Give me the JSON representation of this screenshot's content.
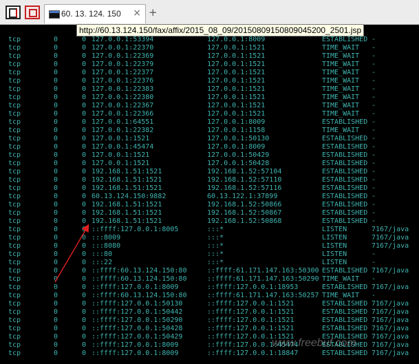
{
  "tab": {
    "title": "60. 13. 124. 150",
    "close_glyph": "×",
    "new_tab_glyph": "+"
  },
  "tooltip": "http://60.13.124.150/fax/affix/2015_08_09/20150809150809045200_2501.jsp",
  "colors": {
    "terminal_bg": "#000000",
    "terminal_text": "#3fb4b0",
    "arrow": "#e02020"
  },
  "icons": {
    "app": "terminal-window-icon",
    "close_all": "close-all-tabs-icon",
    "tab": "console-icon"
  },
  "rows": [
    [
      "tcp",
      "0",
      "0",
      "127.0.0.1:53394",
      "127.0.0.1:8009",
      "ESTABLISHED",
      "-"
    ],
    [
      "tcp",
      "0",
      "0",
      "127.0.0.1:22370",
      "127.0.0.1:1521",
      "TIME_WAIT",
      "-"
    ],
    [
      "tcp",
      "0",
      "0",
      "127.0.0.1:22369",
      "127.0.0.1:1521",
      "TIME_WAIT",
      "-"
    ],
    [
      "tcp",
      "0",
      "0",
      "127.0.0.1:22379",
      "127.0.0.1:1521",
      "TIME_WAIT",
      "-"
    ],
    [
      "tcp",
      "0",
      "0",
      "127.0.0.1:22377",
      "127.0.0.1:1521",
      "TIME_WAIT",
      "-"
    ],
    [
      "tcp",
      "0",
      "0",
      "127.0.0.1:22376",
      "127.0.0.1:1521",
      "TIME_WAIT",
      "-"
    ],
    [
      "tcp",
      "0",
      "0",
      "127.0.0.1:22383",
      "127.0.0.1:1521",
      "TIME_WAIT",
      "-"
    ],
    [
      "tcp",
      "0",
      "0",
      "127.0.0.1:22380",
      "127.0.0.1:1521",
      "TIME_WAIT",
      "-"
    ],
    [
      "tcp",
      "0",
      "0",
      "127.0.0.1:22367",
      "127.0.0.1:1521",
      "TIME_WAIT",
      "-"
    ],
    [
      "tcp",
      "0",
      "0",
      "127.0.0.1:22366",
      "127.0.0.1:1521",
      "TIME_WAIT",
      "-"
    ],
    [
      "tcp",
      "0",
      "0",
      "127.0.0.1:64551",
      "127.0.0.1:8009",
      "ESTABLISHED",
      "-"
    ],
    [
      "tcp",
      "0",
      "0",
      "127.0.0.1:22382",
      "127.0.0.1:1158",
      "TIME_WAIT",
      "-"
    ],
    [
      "tcp",
      "0",
      "0",
      "127.0.0.1:1521",
      "127.0.0.1:50130",
      "ESTABLISHED",
      "-"
    ],
    [
      "tcp",
      "0",
      "0",
      "127.0.0.1:45474",
      "127.0.0.1:8009",
      "ESTABLISHED",
      "-"
    ],
    [
      "tcp",
      "0",
      "0",
      "127.0.0.1:1521",
      "127.0.0.1:50429",
      "ESTABLISHED",
      "-"
    ],
    [
      "tcp",
      "0",
      "0",
      "127.0.0.1:1521",
      "127.0.0.1:50428",
      "ESTABLISHED",
      "-"
    ],
    [
      "tcp",
      "0",
      "0",
      "192.168.1.51:1521",
      "192.168.1.52:57104",
      "ESTABLISHED",
      "-"
    ],
    [
      "tcp",
      "0",
      "0",
      "192.168.1.51:1521",
      "192.168.1.52:57110",
      "ESTABLISHED",
      "-"
    ],
    [
      "tcp",
      "0",
      "0",
      "192.168.1.51:1521",
      "192.168.1.52:57116",
      "ESTABLISHED",
      "-"
    ],
    [
      "tcp",
      "0",
      "0",
      "60.13.124.150:9882",
      "60.13.122.1:37899",
      "ESTABLISHED",
      "-"
    ],
    [
      "tcp",
      "0",
      "0",
      "192.168.1.51:1521",
      "192.168.1.52:50866",
      "ESTABLISHED",
      "-"
    ],
    [
      "tcp",
      "0",
      "0",
      "192.168.1.51:1521",
      "192.168.1.52:50867",
      "ESTABLISHED",
      "-"
    ],
    [
      "tcp",
      "0",
      "0",
      "192.168.1.51:1521",
      "192.168.1.52:50868",
      "ESTABLISHED",
      "-"
    ],
    [
      "tcp",
      "0",
      "0",
      "::ffff:127.0.0.1:8005",
      ":::*",
      "LISTEN",
      "7167/java"
    ],
    [
      "tcp",
      "0",
      "0",
      ":::8009",
      ":::*",
      "LISTEN",
      "7167/java"
    ],
    [
      "tcp",
      "0",
      "0",
      ":::8080",
      ":::*",
      "LISTEN",
      "7167/java"
    ],
    [
      "tcp",
      "0",
      "0",
      ":::80",
      ":::*",
      "LISTEN",
      "-"
    ],
    [
      "tcp",
      "0",
      "0",
      ":::22",
      ":::*",
      "LISTEN",
      "-"
    ],
    [
      "tcp",
      "0",
      "0",
      "::ffff:60.13.124.150:80",
      "::ffff:61.171.147.163:50300",
      "ESTABLISHED",
      "7167/java"
    ],
    [
      "tcp",
      "0",
      "0",
      "::ffff:60.13.124.150:80",
      "::ffff:61.171.147.163:50290",
      "TIME_WAIT",
      "-"
    ],
    [
      "tcp",
      "0",
      "0",
      "::ffff:127.0.0.1:8009",
      "::ffff:127.0.0.1:18953",
      "ESTABLISHED",
      "7167/java"
    ],
    [
      "tcp",
      "0",
      "0",
      "::ffff:60.13.124.150:80",
      "::ffff:61.171.147.163:50257",
      "TIME_WAIT",
      "-"
    ],
    [
      "tcp",
      "0",
      "0",
      "::ffff:127.0.0.1:50130",
      "::ffff:127.0.0.1:1521",
      "ESTABLISHED",
      "7167/java"
    ],
    [
      "tcp",
      "0",
      "0",
      "::ffff:127.0.0.1:50442",
      "::ffff:127.0.0.1:1521",
      "ESTABLISHED",
      "7167/java"
    ],
    [
      "tcp",
      "0",
      "0",
      "::ffff:127.0.0.1:50290",
      "::ffff:127.0.0.1:1521",
      "ESTABLISHED",
      "7167/java"
    ],
    [
      "tcp",
      "0",
      "0",
      "::ffff:127.0.0.1:50428",
      "::ffff:127.0.0.1:1521",
      "ESTABLISHED",
      "7167/java"
    ],
    [
      "tcp",
      "0",
      "0",
      "::ffff:127.0.0.1:50429",
      "::ffff:127.0.0.1:1521",
      "ESTABLISHED",
      "7167/java"
    ],
    [
      "tcp",
      "0",
      "0",
      "::ffff:127.0.0.1:8009",
      "::ffff:127.0.0.1:45474",
      "ESTABLISHED",
      "7167/java"
    ],
    [
      "tcp",
      "0",
      "0",
      "::ffff:127.0.0.1:8009",
      "::ffff:127.0.0.1:18847",
      "ESTABLISHED",
      "7167/java"
    ]
  ],
  "watermark": "www.freebuf.com"
}
